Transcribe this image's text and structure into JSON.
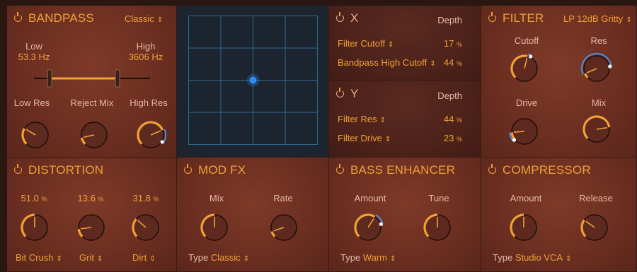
{
  "bandpass": {
    "title": "BANDPASS",
    "mode": "Classic",
    "low_label": "Low",
    "low_value": "53.3 Hz",
    "high_label": "High",
    "high_value": "3606 Hz",
    "knobs": [
      {
        "label": "Low Res",
        "value": 0.28
      },
      {
        "label": "Reject Mix",
        "value": 0.12
      },
      {
        "label": "High Res",
        "value": 0.75,
        "mod": 0.95
      }
    ]
  },
  "xy": {
    "dot_x": 0.5,
    "dot_y": 0.5
  },
  "x_mod": {
    "title": "X",
    "depth_label": "Depth",
    "rows": [
      {
        "label": "Filter Cutoff",
        "value": "17",
        "unit": "%"
      },
      {
        "label": "Bandpass High Cutoff",
        "value": "44",
        "unit": "%"
      }
    ]
  },
  "y_mod": {
    "title": "Y",
    "depth_label": "Depth",
    "rows": [
      {
        "label": "Filter Res",
        "value": "44",
        "unit": "%"
      },
      {
        "label": "Filter Drive",
        "value": "23",
        "unit": "%"
      }
    ]
  },
  "filter": {
    "title": "FILTER",
    "mode": "LP 12dB Gritty",
    "knobs": [
      {
        "label": "Cutoff",
        "value": 0.55,
        "mod": 0.6
      },
      {
        "label": "Res",
        "value": 0.08,
        "mod": 0.8
      },
      {
        "label": "Drive",
        "value": 0.15,
        "mod": 0.02
      },
      {
        "label": "Mix",
        "value": 0.8
      }
    ]
  },
  "distortion": {
    "title": "DISTORTION",
    "values": [
      {
        "value": "51.0",
        "unit": "%",
        "knob": 0.5
      },
      {
        "value": "13.6",
        "unit": "%",
        "knob": 0.14
      },
      {
        "value": "31.8",
        "unit": "%",
        "knob": 0.32
      }
    ],
    "types": [
      "Bit Crush",
      "Grit",
      "Dirt"
    ]
  },
  "modfx": {
    "title": "MOD FX",
    "knobs": [
      {
        "label": "Mix",
        "value": 0.5
      },
      {
        "label": "Rate",
        "value": 0.1
      }
    ],
    "type_label": "Type",
    "type_value": "Classic"
  },
  "bass": {
    "title": "BASS ENHANCER",
    "knobs": [
      {
        "label": "Amount",
        "value": 0.62,
        "mod": 0.78
      },
      {
        "label": "Tune",
        "value": 0.5
      }
    ],
    "type_label": "Type",
    "type_value": "Warm"
  },
  "compressor": {
    "title": "COMPRESSOR",
    "knobs": [
      {
        "label": "Amount",
        "value": 0.5
      },
      {
        "label": "Release",
        "value": 0.3
      }
    ],
    "type_label": "Type",
    "type_value": "Studio VCA"
  },
  "colors": {
    "accent": "#f1a136",
    "mod": "#4a8fe0",
    "pad_dot": "#2f8ef0"
  }
}
